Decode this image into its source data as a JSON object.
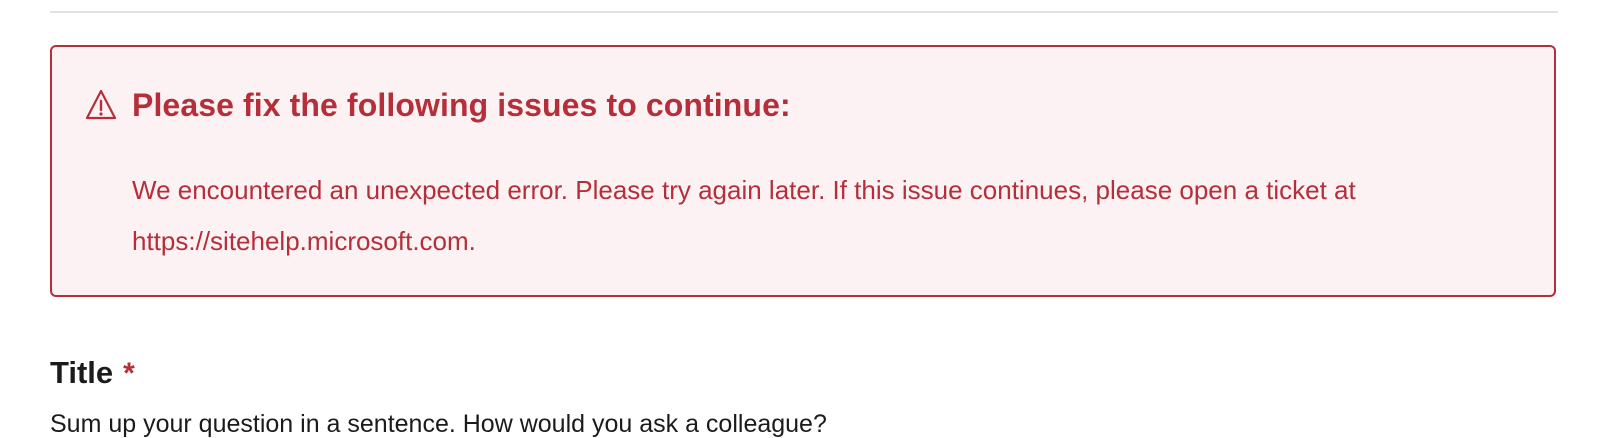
{
  "error_banner": {
    "icon": "warning-icon",
    "title": "Please fix the following issues to continue:",
    "message": "We encountered an unexpected error. Please try again later. If this issue continues, please open a ticket at https://sitehelp.microsoft.com."
  },
  "form": {
    "title_field": {
      "label": "Title",
      "required_marker": "*",
      "help_text": "Sum up your question in a sentence. How would you ask a colleague?"
    }
  },
  "colors": {
    "error": "#b52f3a",
    "error_background": "#fcf2f3",
    "divider": "#e1e1e1",
    "text": "#1b1b1b"
  }
}
